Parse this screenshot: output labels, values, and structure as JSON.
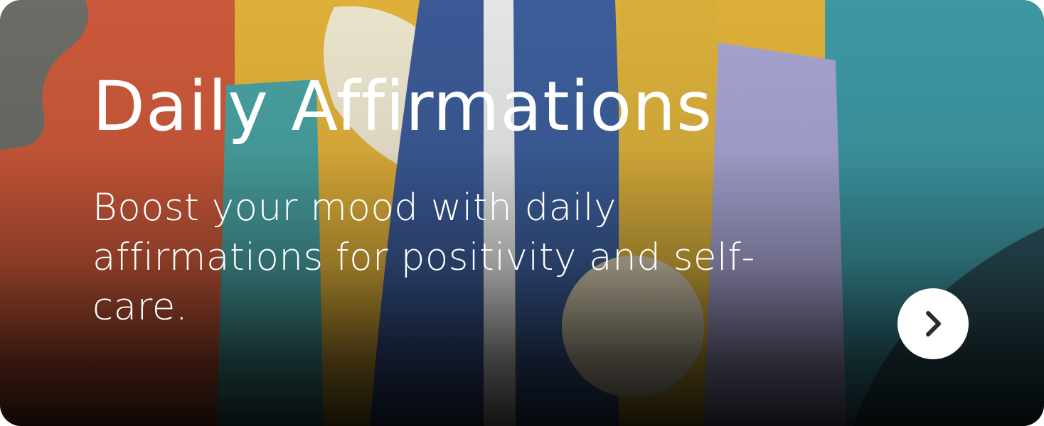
{
  "card": {
    "title": "Daily Affirmations",
    "description": "Boost your mood with daily affirmations for positivity and self-care.",
    "next_button_icon": "chevron-right-icon"
  },
  "colors": {
    "text": "#ffffff",
    "button_bg": "#ffffff",
    "button_icon": "#2b2b2b"
  }
}
